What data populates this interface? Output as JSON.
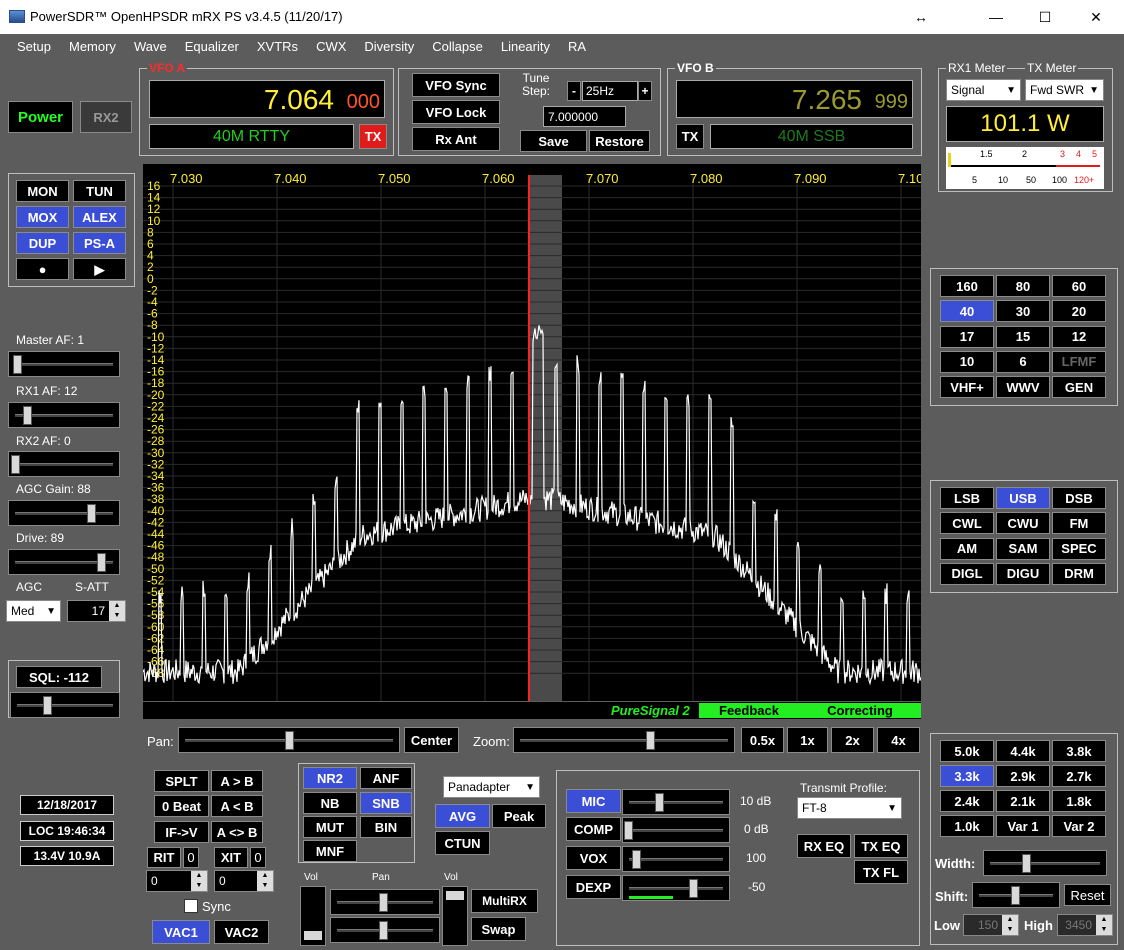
{
  "window": {
    "title": "PowerSDR™ OpenHPSDR mRX PS v3.4.5 (11/20/17)",
    "minimize": "—",
    "maximize": "☐",
    "close": "✕",
    "resize": "↔"
  },
  "menu": [
    "Setup",
    "Memory",
    "Wave",
    "Equalizer",
    "XVTRs",
    "CWX",
    "Diversity",
    "Collapse",
    "Linearity",
    "RA"
  ],
  "power": {
    "power": "Power",
    "rx2": "RX2"
  },
  "vfoa": {
    "label": "VFO A",
    "freq_main": "7.064",
    "freq_sub": "000",
    "band": "40M RTTY",
    "tx": "TX"
  },
  "vfob": {
    "label": "VFO B",
    "freq_main": "7.265",
    "freq_sub": "999",
    "band": "40M SSB",
    "tx": "TX"
  },
  "mid": {
    "vfo_sync": "VFO Sync",
    "vfo_lock": "VFO Lock",
    "rx_ant": "Rx Ant",
    "tune_step_label": "Tune\nStep:",
    "tune_step": "25Hz",
    "minus": "-",
    "plus": "+",
    "freq": "7.000000",
    "save": "Save",
    "restore": "Restore"
  },
  "meter": {
    "rx1": "RX1 Meter",
    "tx": "TX Meter",
    "rx_sel": "Signal",
    "tx_sel": "Fwd SWR",
    "value": "101.1 W",
    "top_scale": [
      "1.5",
      "2",
      "3",
      "4",
      "5"
    ],
    "bottom_scale": [
      "5",
      "10",
      "50",
      "100",
      "120+"
    ]
  },
  "modes_left": {
    "mon": "MON",
    "tun": "TUN",
    "mox": "MOX",
    "alex": "ALEX",
    "dup": "DUP",
    "psa": "PS-A",
    "rec": "●",
    "play": "▶"
  },
  "gains": {
    "master": "Master AF:  1",
    "rx1": "RX1 AF:  12",
    "rx2": "RX2 AF:  0",
    "agc_gain": "AGC Gain:  88",
    "drive": "Drive:  89",
    "agc": "AGC",
    "satt": "S-ATT",
    "agc_val": "Med",
    "satt_val": "17",
    "sql": "SQL:  -112"
  },
  "freq_ticks": [
    "7.030",
    "7.040",
    "7.050",
    "7.060",
    "7.070",
    "7.080",
    "7.090",
    "7.10"
  ],
  "db_ticks": [
    "16",
    "14",
    "12",
    "10",
    "8",
    "6",
    "4",
    "2",
    "0",
    "-2",
    "-4",
    "-6",
    "-8",
    "-10",
    "-12",
    "-14",
    "-16",
    "-18",
    "-20",
    "-22",
    "-24",
    "-26",
    "-28",
    "-30",
    "-32",
    "-34",
    "-36",
    "-38",
    "-40",
    "-42",
    "-44",
    "-46",
    "-48",
    "-50",
    "-52",
    "-54",
    "-56",
    "-58",
    "-60",
    "-62",
    "-64",
    "-66",
    "-68"
  ],
  "status": {
    "ps": "PureSignal 2",
    "feedback": "Feedback",
    "correcting": "Correcting"
  },
  "pan": {
    "pan": "Pan:",
    "center": "Center",
    "zoom": "Zoom:",
    "z05": "0.5x",
    "z1": "1x",
    "z2": "2x",
    "z4": "4x"
  },
  "bands": [
    "160",
    "80",
    "60",
    "40",
    "30",
    "20",
    "17",
    "15",
    "12",
    "10",
    "6",
    "LFMF",
    "VHF+",
    "WWV",
    "GEN"
  ],
  "modes": [
    "LSB",
    "USB",
    "DSB",
    "CWL",
    "CWU",
    "FM",
    "AM",
    "SAM",
    "SPEC",
    "DIGL",
    "DIGU",
    "DRM"
  ],
  "filters": [
    "5.0k",
    "4.4k",
    "3.8k",
    "3.3k",
    "2.9k",
    "2.7k",
    "2.4k",
    "2.1k",
    "1.8k",
    "1.0k",
    "Var 1",
    "Var 2"
  ],
  "filter_ctl": {
    "width": "Width:",
    "shift": "Shift:",
    "reset": "Reset",
    "low": "Low",
    "low_val": "150",
    "high": "High",
    "high_val": "3450"
  },
  "info": {
    "date": "12/18/2017",
    "time": "LOC 19:46:34",
    "volt": "13.4V  10.9A"
  },
  "split": {
    "splt": "SPLT",
    "atob": "A > B",
    "zbeat": "0 Beat",
    "altb": "A < B",
    "ifv": "IF->V",
    "aswap": "A <> B",
    "rit": "RIT",
    "rit_v": "0",
    "xit": "XIT",
    "xit_v": "0",
    "rit_spin": "0",
    "xit_spin": "0",
    "sync": "Sync",
    "vac1": "VAC1",
    "vac2": "VAC2"
  },
  "nr": {
    "nr2": "NR2",
    "anf": "ANF",
    "nb": "NB",
    "snb": "SNB",
    "mut": "MUT",
    "bin": "BIN",
    "mnf": "MNF"
  },
  "disp": {
    "mode": "Panadapter",
    "avg": "AVG",
    "peak": "Peak",
    "ctun": "CTUN"
  },
  "vol": {
    "vol1": "Vol",
    "pan": "Pan",
    "vol2": "Vol",
    "multirx": "MultiRX",
    "swap": "Swap"
  },
  "tx": {
    "mic": "MIC",
    "mic_v": "10 dB",
    "comp": "COMP",
    "comp_v": "0 dB",
    "vox": "VOX",
    "vox_v": "100",
    "dexp": "DEXP",
    "dexp_v": "-50",
    "profile_lbl": "Transmit Profile:",
    "profile": "FT-8",
    "rxeq": "RX EQ",
    "txeq": "TX EQ",
    "txfl": "TX FL"
  }
}
